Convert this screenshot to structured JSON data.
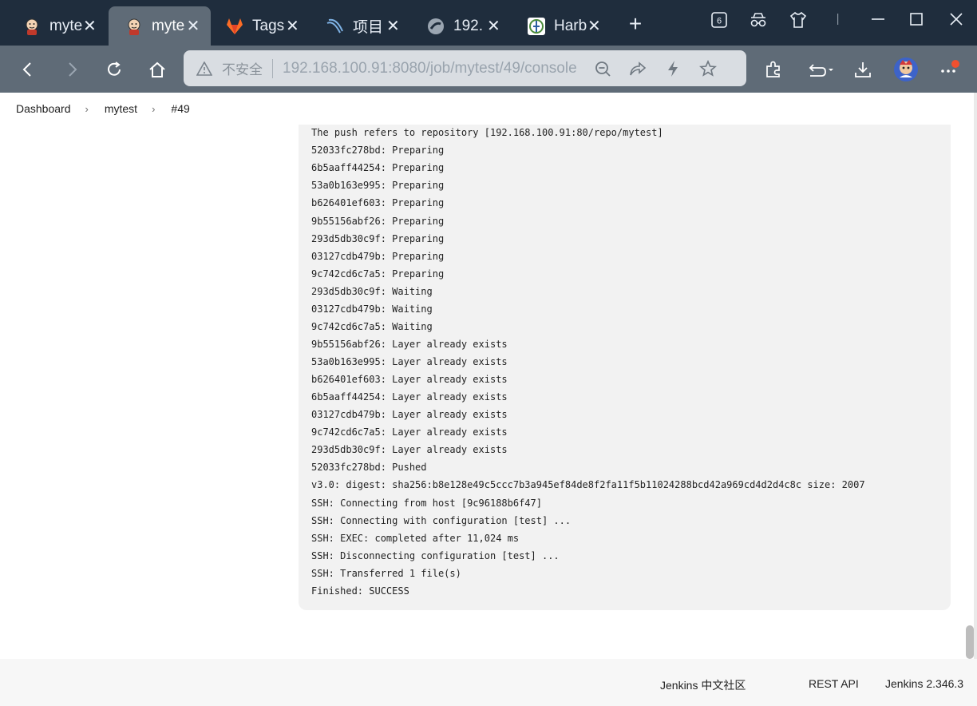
{
  "tabs": [
    {
      "title": "mytest",
      "icon": "jenkins-icon",
      "active": false
    },
    {
      "title": "mytest",
      "icon": "jenkins-icon",
      "active": true
    },
    {
      "title": "Tags",
      "icon": "gitlab-icon",
      "active": false
    },
    {
      "title": "项目",
      "icon": "wave-icon",
      "active": false
    },
    {
      "title": "192.",
      "icon": "globe-icon",
      "active": false
    },
    {
      "title": "Harb",
      "icon": "harbor-icon",
      "active": false
    }
  ],
  "tab_close": "✕",
  "new_tab": "+",
  "tab_count": "6",
  "address": {
    "security": "不安全",
    "url": "192.168.100.91:8080/job/mytest/49/console"
  },
  "breadcrumb": {
    "items": [
      "Dashboard",
      "mytest",
      "#49"
    ],
    "separator": "›"
  },
  "console": {
    "lines": [
      "The push refers to repository [192.168.100.91:80/repo/mytest]",
      "52033fc278bd: Preparing",
      "6b5aaff44254: Preparing",
      "53a0b163e995: Preparing",
      "b626401ef603: Preparing",
      "9b55156abf26: Preparing",
      "293d5db30c9f: Preparing",
      "03127cdb479b: Preparing",
      "9c742cd6c7a5: Preparing",
      "293d5db30c9f: Waiting",
      "03127cdb479b: Waiting",
      "9c742cd6c7a5: Waiting",
      "9b55156abf26: Layer already exists",
      "53a0b163e995: Layer already exists",
      "b626401ef603: Layer already exists",
      "6b5aaff44254: Layer already exists",
      "03127cdb479b: Layer already exists",
      "9c742cd6c7a5: Layer already exists",
      "293d5db30c9f: Layer already exists",
      "52033fc278bd: Pushed",
      "v3.0: digest: sha256:b8e128e49c5ccc7b3a945ef84de8f2fa11f5b11024288bcd42a969cd4d2d4c8c size: 2007",
      "SSH: Connecting from host [9c96188b6f47]",
      "SSH: Connecting with configuration [test] ...",
      "SSH: EXEC: completed after 11,024 ms",
      "SSH: Disconnecting configuration [test] ...",
      "SSH: Transferred 1 file(s)",
      "Finished: SUCCESS"
    ]
  },
  "footer": {
    "community": "Jenkins 中文社区",
    "rest_api": "REST API",
    "version": "Jenkins 2.346.3"
  },
  "colors": {
    "tab_strip": "#1f2d3d",
    "toolbar": "#5f6b77",
    "console_bg": "#f2f2f2"
  }
}
